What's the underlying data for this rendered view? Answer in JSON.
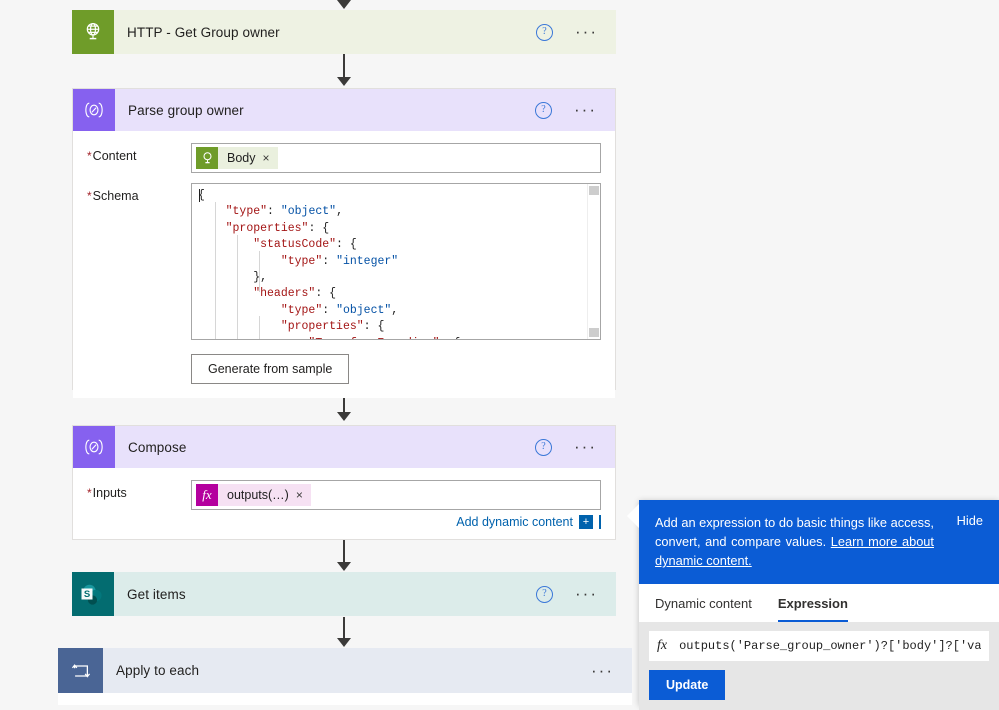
{
  "flow": {
    "steps": [
      {
        "id": "http",
        "title": "HTTP - Get Group owner",
        "icon": "globe-icon",
        "help": "?",
        "ellipsis": "···"
      },
      {
        "id": "parse",
        "title": "Parse group owner",
        "icon": "parse-json-icon",
        "help": "?",
        "ellipsis": "···",
        "fields": {
          "content_label": "Content",
          "content_token": "Body",
          "content_token_close": "×",
          "schema_label": "Schema",
          "generate_button": "Generate from sample"
        }
      },
      {
        "id": "compose",
        "title": "Compose",
        "icon": "compose-icon",
        "help": "?",
        "ellipsis": "···",
        "fields": {
          "inputs_label": "Inputs",
          "inputs_token": "outputs(…)",
          "inputs_token_close": "×",
          "inputs_token_badge": "fx",
          "add_dynamic_content": "Add dynamic content",
          "add_dynamic_plus": "+"
        }
      },
      {
        "id": "getitems",
        "title": "Get items",
        "icon": "sharepoint-icon",
        "help": "?",
        "ellipsis": "···"
      },
      {
        "id": "loop",
        "title": "Apply to each",
        "icon": "apply-to-each-icon",
        "ellipsis": "···"
      }
    ]
  },
  "schema_code": [
    {
      "indent": 0,
      "parts": [
        {
          "t": "{",
          "c": "p"
        }
      ]
    },
    {
      "indent": 1,
      "parts": [
        {
          "t": "\"type\"",
          "c": "k"
        },
        {
          "t": ": ",
          "c": "p"
        },
        {
          "t": "\"object\"",
          "c": "v"
        },
        {
          "t": ",",
          "c": "p"
        }
      ]
    },
    {
      "indent": 1,
      "parts": [
        {
          "t": "\"properties\"",
          "c": "k"
        },
        {
          "t": ": {",
          "c": "p"
        }
      ]
    },
    {
      "indent": 2,
      "parts": [
        {
          "t": "\"statusCode\"",
          "c": "k"
        },
        {
          "t": ": {",
          "c": "p"
        }
      ]
    },
    {
      "indent": 3,
      "parts": [
        {
          "t": "\"type\"",
          "c": "k"
        },
        {
          "t": ": ",
          "c": "p"
        },
        {
          "t": "\"integer\"",
          "c": "v"
        }
      ]
    },
    {
      "indent": 2,
      "parts": [
        {
          "t": "},",
          "c": "p"
        }
      ]
    },
    {
      "indent": 2,
      "parts": [
        {
          "t": "\"headers\"",
          "c": "k"
        },
        {
          "t": ": {",
          "c": "p"
        }
      ]
    },
    {
      "indent": 3,
      "parts": [
        {
          "t": "\"type\"",
          "c": "k"
        },
        {
          "t": ": ",
          "c": "p"
        },
        {
          "t": "\"object\"",
          "c": "v"
        },
        {
          "t": ",",
          "c": "p"
        }
      ]
    },
    {
      "indent": 3,
      "parts": [
        {
          "t": "\"properties\"",
          "c": "k"
        },
        {
          "t": ": {",
          "c": "p"
        }
      ]
    },
    {
      "indent": 4,
      "parts": [
        {
          "t": "\"Transfer-Encoding\"",
          "c": "k"
        },
        {
          "t": ": {",
          "c": "p"
        }
      ]
    }
  ],
  "expression_panel": {
    "banner_text_1": "Add an expression to do basic things like access, convert, and compare values. ",
    "banner_link": "Learn more about dynamic content.",
    "hide_label": "Hide",
    "tabs": [
      {
        "label": "Dynamic content",
        "active": false
      },
      {
        "label": "Expression",
        "active": true
      }
    ],
    "fx_label": "fx",
    "expression_value": "outputs('Parse_group_owner')?['body']?['va",
    "update_label": "Update"
  },
  "colors": {
    "http_header": "#eef2e3",
    "http_icon": "#6f9c29",
    "parse_header": "#e8e1fb",
    "parse_icon": "#8661ef",
    "getitems_header": "#dcecea",
    "getitems_icon": "#036c70",
    "loop_header": "#e6eaf2",
    "loop_icon": "#4a6595",
    "accent_blue": "#0b5cd5",
    "link_blue": "#0062ad",
    "required_red": "#a4262c",
    "token_pink": "#f6e1f3",
    "token_fx": "#b4009e",
    "token_green": "#eaf0de"
  }
}
